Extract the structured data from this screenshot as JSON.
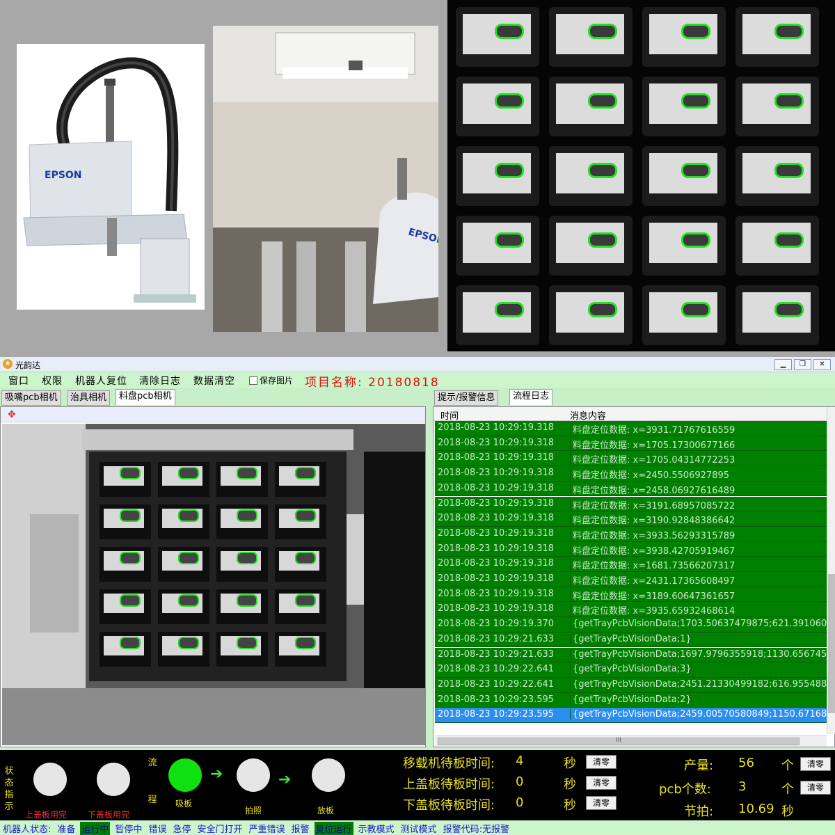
{
  "photos": {
    "robot_brand": "EPSON",
    "cell_robot_brand": "EPSON"
  },
  "window": {
    "title": "光韵达",
    "min_icon": "minimize-icon",
    "max_icon": "maximize-icon",
    "close_icon": "close-icon"
  },
  "menu": {
    "items": [
      "窗口",
      "权限",
      "机器人复位",
      "清除日志",
      "数据清空"
    ],
    "save_image": "保存图片",
    "project_label": "项目名称:",
    "project_name": "20180818"
  },
  "camera_tabs": [
    "吸嘴pcb相机",
    "治具相机",
    "料盘pcb相机"
  ],
  "camera_active_tab": "料盘pcb相机",
  "log_tabs": [
    "提示/报警信息",
    "流程日志"
  ],
  "log_active_tab": "流程日志",
  "log": {
    "col_time": "时间",
    "col_msg": "消息内容",
    "rows": [
      {
        "time": "2018-08-23 10:29:19.318",
        "msg": "料盘定位数据: x=3931.71767616559"
      },
      {
        "time": "2018-08-23 10:29:19.318",
        "msg": "料盘定位数据: x=1705.17300677166"
      },
      {
        "time": "2018-08-23 10:29:19.318",
        "msg": "料盘定位数据: x=1705.04314772253"
      },
      {
        "time": "2018-08-23 10:29:19.318",
        "msg": "料盘定位数据: x=2450.5506927895"
      },
      {
        "time": "2018-08-23 10:29:19.318",
        "msg": "料盘定位数据: x=2458.06927616489"
      },
      {
        "time": "2018-08-23 10:29:19.318",
        "msg": "料盘定位数据: x=3191.68957085722"
      },
      {
        "time": "2018-08-23 10:29:19.318",
        "msg": "料盘定位数据: x=3190.92848386642"
      },
      {
        "time": "2018-08-23 10:29:19.318",
        "msg": "料盘定位数据: x=3933.56293315789"
      },
      {
        "time": "2018-08-23 10:29:19.318",
        "msg": "料盘定位数据: x=3938.42705919467"
      },
      {
        "time": "2018-08-23 10:29:19.318",
        "msg": "料盘定位数据: x=1681.73566207317"
      },
      {
        "time": "2018-08-23 10:29:19.318",
        "msg": "料盘定位数据: x=2431.17365608497"
      },
      {
        "time": "2018-08-23 10:29:19.318",
        "msg": "料盘定位数据: x=3189.60647361657"
      },
      {
        "time": "2018-08-23 10:29:19.318",
        "msg": "料盘定位数据: x=3935.65932468614"
      },
      {
        "time": "2018-08-23 10:29:19.370",
        "msg": "{getTrayPcbVisionData;1703.50637479875;621.391060"
      },
      {
        "time": "2018-08-23 10:29:21.633",
        "msg": "{getTrayPcbVisionData;1}"
      },
      {
        "time": "2018-08-23 10:29:21.633",
        "msg": "{getTrayPcbVisionData;1697.9796355918;1130.656745"
      },
      {
        "time": "2018-08-23 10:29:22.641",
        "msg": "{getTrayPcbVisionData;3}"
      },
      {
        "time": "2018-08-23 10:29:22.641",
        "msg": "{getTrayPcbVisionData;2451.21330499182;616.955488"
      },
      {
        "time": "2018-08-23 10:29:23.595",
        "msg": "{getTrayPcbVisionData;2}"
      },
      {
        "time": "2018-08-23 10:29:23.595",
        "msg": "{getTrayPcbVisionData;2459.00570580849;1150.67168"
      }
    ],
    "selected_index": 19,
    "hscroll_mark": "III"
  },
  "status": {
    "indicator_label": "状态指示",
    "flow_label": "流程",
    "circles": [
      {
        "label": "上盖板用完",
        "active": false,
        "label_color": "#ff3030"
      },
      {
        "label": "下盖板用完",
        "active": false,
        "label_color": "#ff3030"
      },
      {
        "label": "吸板",
        "active": true,
        "label_color": "#e8e020"
      },
      {
        "label": "拍照",
        "active": false,
        "label_color": "#e8e020"
      },
      {
        "label": "放板",
        "active": false,
        "label_color": "#e8e020"
      }
    ],
    "waits": [
      {
        "label": "移载机待板时间:",
        "value": "4",
        "unit": "秒",
        "button": "清零"
      },
      {
        "label": "上盖板待板时间:",
        "value": "0",
        "unit": "秒",
        "button": "清零"
      },
      {
        "label": "下盖板待板时间:",
        "value": "0",
        "unit": "秒",
        "button": "清零"
      }
    ],
    "output": {
      "label": "产量:",
      "value": "56",
      "unit": "个",
      "button": "清零"
    },
    "pcb_count": {
      "label": "pcb个数:",
      "value": "3",
      "unit": "个",
      "button": "清零"
    },
    "takt": {
      "label": "节拍:",
      "value": "10.69",
      "unit": "秒"
    }
  },
  "statusbar": {
    "items": [
      "机器人状态:",
      "准备",
      "运行中",
      "暂停中",
      "错误",
      "急停",
      "安全门打开",
      "严重错误",
      "报警",
      "复位运行",
      "示教模式",
      "测试模式",
      "报警代码:无报警"
    ],
    "highlighted": [
      2,
      9
    ]
  },
  "colors": {
    "log_row_bg": "#008000",
    "selected_row": "#2a8ef0",
    "active_circle": "#10e010",
    "yellow_text": "#e8e020",
    "project_red": "#e01010"
  }
}
